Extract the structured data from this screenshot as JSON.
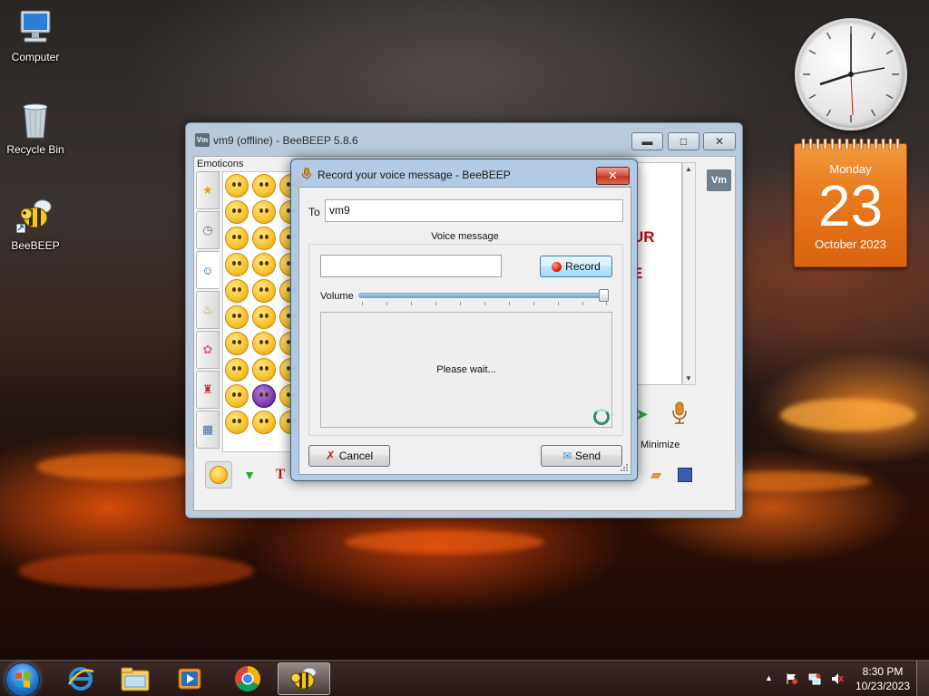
{
  "desktop": {
    "icons": [
      {
        "label": "Computer"
      },
      {
        "label": "Recycle Bin"
      },
      {
        "label": "BeeBEEP"
      }
    ]
  },
  "gadgets": {
    "calendar": {
      "weekday": "Monday",
      "day": "23",
      "month_year": "October 2023"
    }
  },
  "main_window": {
    "title": "vm9 (offline) - BeeBEEP 5.8.6",
    "icon_text": "Vm",
    "emoticons_label": "Emoticons",
    "badge": "Vm",
    "chat_fragments": [
      "UR",
      "E"
    ],
    "minimize_label": "Minimize",
    "side_tabs": [
      "star-icon",
      "clock-icon",
      "people-icon",
      "bell-icon",
      "flower-icon",
      "toy-icon",
      "symbols-icon"
    ]
  },
  "record_dialog": {
    "title": "Record your voice message - BeeBEEP",
    "to_label": "To",
    "to_value": "vm9",
    "group_title": "Voice message",
    "record_label": "Record",
    "volume_label": "Volume",
    "volume_level": 1.0,
    "status_text": "Please wait...",
    "cancel_label": "Cancel",
    "send_label": "Send"
  },
  "taskbar": {
    "time": "8:30 PM",
    "date": "10/23/2023",
    "pinned": [
      "internet-explorer-icon",
      "file-explorer-icon",
      "media-player-icon",
      "chrome-icon",
      "beebeep-icon"
    ]
  }
}
